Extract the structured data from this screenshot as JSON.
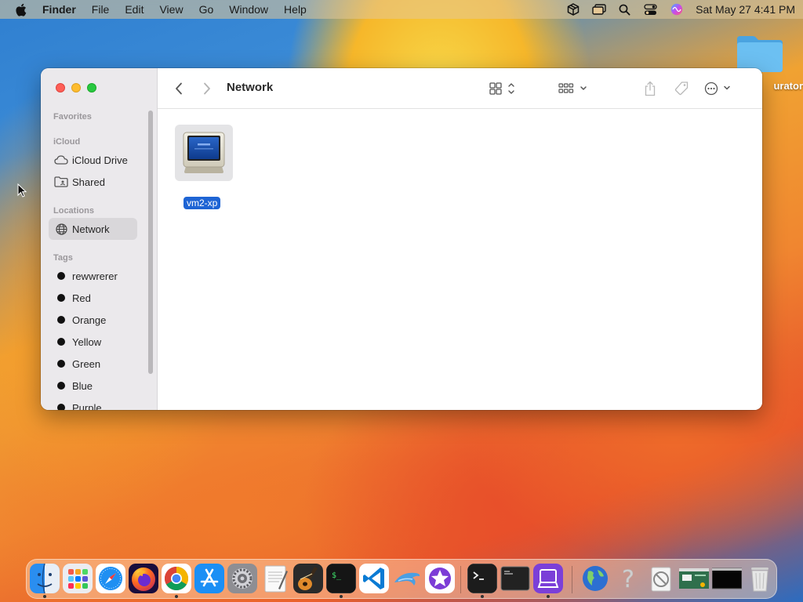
{
  "menubar": {
    "app_name": "Finder",
    "menus": [
      "File",
      "Edit",
      "View",
      "Go",
      "Window",
      "Help"
    ],
    "clock": "Sat May 27  4:41 PM"
  },
  "desktop": {
    "folder_label": "urator"
  },
  "window": {
    "title": "Network",
    "sidebar": {
      "favorites_header": "Favorites",
      "icloud_header": "iCloud",
      "icloud_items": [
        {
          "label": "iCloud Drive",
          "icon": "cloud-icon"
        },
        {
          "label": "Shared",
          "icon": "shared-folder-icon"
        }
      ],
      "locations_header": "Locations",
      "locations_items": [
        {
          "label": "Network",
          "icon": "globe-icon",
          "selected": true
        }
      ],
      "tags_header": "Tags",
      "tags": [
        "rewwrerer",
        "Red",
        "Orange",
        "Yellow",
        "Green",
        "Blue",
        "Purple"
      ]
    },
    "content": {
      "items": [
        {
          "label": "vm2-xp",
          "icon": "crt-monitor-icon",
          "selected": true
        }
      ]
    }
  },
  "dock": {
    "apps": [
      {
        "name": "finder-icon",
        "color": "#3a8ef0",
        "running": true
      },
      {
        "name": "launchpad-icon",
        "color": "#e9e9ee",
        "running": false
      },
      {
        "name": "safari-icon",
        "color": "#2a8ff0",
        "running": false
      },
      {
        "name": "firefox-icon",
        "color": "#7a3fd0",
        "running": false
      },
      {
        "name": "chrome-icon",
        "color": "#ffffff",
        "running": true
      },
      {
        "name": "app-store-icon",
        "color": "#1a8ef5",
        "running": false
      },
      {
        "name": "system-settings-icon",
        "color": "#8e8e93",
        "running": false
      },
      {
        "name": "textedit-icon",
        "color": "#f4f4f4",
        "running": false
      },
      {
        "name": "garageband-icon",
        "color": "#2a2a2a",
        "running": false
      },
      {
        "name": "terminal-green-icon",
        "color": "#151515",
        "running": true
      },
      {
        "name": "vscode-icon",
        "color": "#ffffff",
        "running": false
      },
      {
        "name": "dolphin-icon",
        "color": "#5aa9e6",
        "running": false
      },
      {
        "name": "imovie-star-icon",
        "color": "#ffffff",
        "running": false
      },
      {
        "name": "terminal-icon",
        "color": "#1c1c1c",
        "running": true
      },
      {
        "name": "console-icon",
        "color": "#222222",
        "running": false
      },
      {
        "name": "utm-icon",
        "color": "#7b3fd8",
        "running": true
      },
      {
        "name": "globe-app-icon",
        "color": "#2c6fd1",
        "running": false
      },
      {
        "name": "help-icon",
        "color": "#c8c8c8",
        "running": false
      },
      {
        "name": "script-editor-icon",
        "color": "#e8e8e8",
        "running": false
      },
      {
        "name": "window-thumbnail-1-icon",
        "color": "#2f6f4c",
        "running": false
      },
      {
        "name": "window-thumbnail-2-icon",
        "color": "#050505",
        "running": false
      },
      {
        "name": "trash-icon",
        "color": "#dcdcdc",
        "running": false
      }
    ]
  }
}
